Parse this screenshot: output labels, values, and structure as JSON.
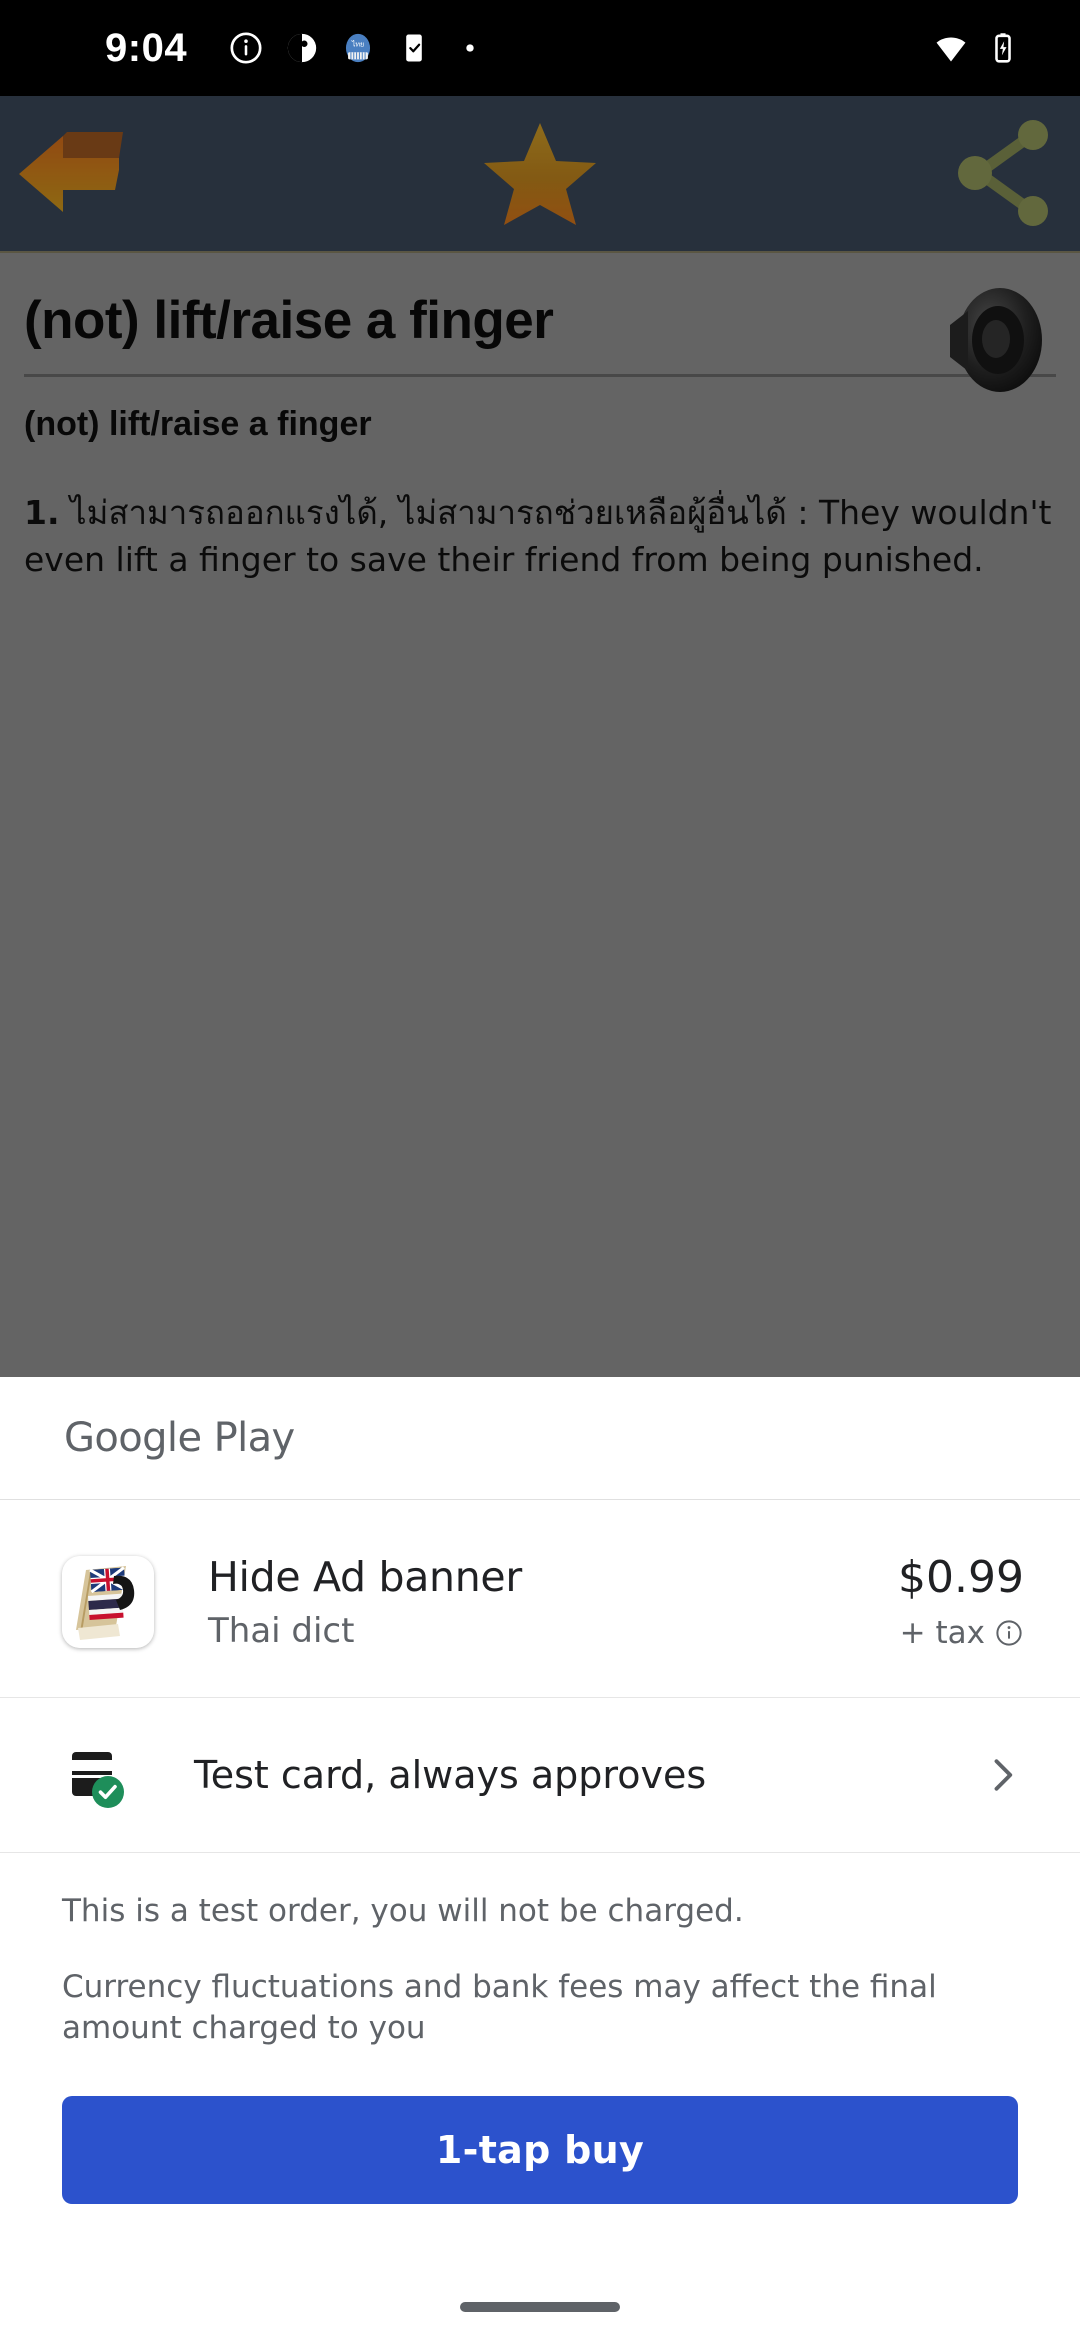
{
  "status_bar": {
    "time": "9:04",
    "left_icons": [
      "info-icon",
      "do-not-disturb-icon",
      "thai-dict-app-icon",
      "task-checklist-icon",
      "dot-icon"
    ],
    "right_icons": [
      "wifi-icon",
      "battery-charging-icon"
    ]
  },
  "app": {
    "toolbar": {
      "back_label": "Back",
      "favorite_label": "Favorite",
      "share_label": "Share"
    },
    "entry": {
      "title": "(not) lift/raise a finger",
      "headword": "(not) lift/raise a finger",
      "definition_number": "1.",
      "definition_thai": "ไม่สามารถออกแรงได้, ไม่สามารถช่วยเหลือผู้อื่นได้ :",
      "definition_example": "They wouldn't even lift a finger to save their friend from being punished.",
      "speaker_label": "Pronounce"
    }
  },
  "sheet": {
    "brand": "Google Play",
    "product": {
      "name": "Hide Ad banner",
      "developer": "Thai dict",
      "price": "$0.99",
      "tax_note": "+ tax",
      "tax_info_icon": "info-icon"
    },
    "payment": {
      "method": "Test card, always approves",
      "card_icon": "credit-card-icon",
      "verified_icon": "check-circle-icon",
      "chevron_icon": "chevron-right-icon"
    },
    "notes": [
      "This is a test order, you will not be charged.",
      "Currency fluctuations and bank fees may affect the final amount charged to you"
    ],
    "buy_button": "1-tap buy"
  },
  "colors": {
    "buy_button": "#2c52cc",
    "toolbar": "#3d4a5c",
    "verified_badge": "#1e8e5a",
    "brand_gray": "#5f6368"
  }
}
